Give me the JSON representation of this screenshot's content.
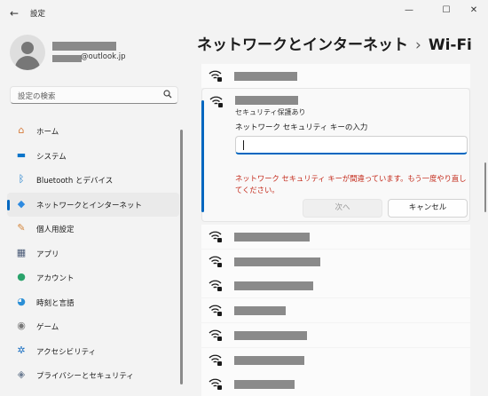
{
  "window": {
    "title": "設定",
    "back_glyph": "←",
    "minimize_glyph": "—",
    "maximize_glyph": "☐",
    "close_glyph": "✕"
  },
  "profile": {
    "email_suffix": "@outlook.jp"
  },
  "search": {
    "placeholder": "設定の検索",
    "icon": "search-icon"
  },
  "sidebar": {
    "items": [
      {
        "label": "ホーム",
        "icon": "home-icon",
        "color": "#d67a3a",
        "glyph": "⌂"
      },
      {
        "label": "システム",
        "icon": "monitor-icon",
        "color": "#0a74c9",
        "glyph": "▬"
      },
      {
        "label": "Bluetooth とデバイス",
        "icon": "bluetooth-icon",
        "color": "#0a74c9",
        "glyph": "ᛒ"
      },
      {
        "label": "ネットワークとインターネット",
        "icon": "wifi-icon",
        "color": "#2d8ae0",
        "glyph": "◆",
        "selected": true
      },
      {
        "label": "個人用設定",
        "icon": "brush-icon",
        "color": "#d4853a",
        "glyph": "✎"
      },
      {
        "label": "アプリ",
        "icon": "apps-icon",
        "color": "#4b5b77",
        "glyph": "▦"
      },
      {
        "label": "アカウント",
        "icon": "account-icon",
        "color": "#2aa36b",
        "glyph": "●"
      },
      {
        "label": "時刻と言語",
        "icon": "globe-clock-icon",
        "color": "#2b8fd6",
        "glyph": "◕"
      },
      {
        "label": "ゲーム",
        "icon": "gamepad-icon",
        "color": "#777777",
        "glyph": "◉"
      },
      {
        "label": "アクセシビリティ",
        "icon": "accessibility-icon",
        "color": "#1a6fc2",
        "glyph": "✲"
      },
      {
        "label": "プライバシーとセキュリティ",
        "icon": "shield-icon",
        "color": "#6a7a90",
        "glyph": "◈"
      }
    ]
  },
  "header": {
    "section": "ネットワークとインターネット",
    "separator": "›",
    "page": "Wi-Fi"
  },
  "expanded_network": {
    "security_type": "セキュリティ保護あり",
    "key_label": "ネットワーク セキュリティ キーの入力",
    "key_value": "",
    "error": "ネットワーク セキュリティ キーが間違っています。もう一度やり直してください。",
    "next_label": "次へ",
    "cancel_label": "キャンセル"
  },
  "colors": {
    "accent": "#0067c0",
    "error": "#c42b1c",
    "redaction": "#8a8a8a"
  }
}
